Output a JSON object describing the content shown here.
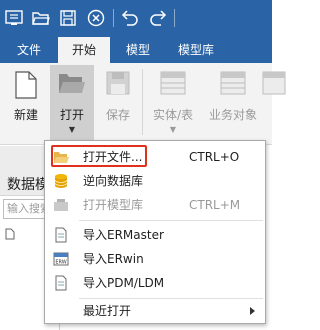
{
  "quick_access": {
    "icons": [
      "app-menu-icon",
      "open-folder-icon",
      "save-icon",
      "close-circle-icon",
      "undo-icon",
      "redo-icon"
    ]
  },
  "tabs": [
    {
      "label": "文件",
      "active": false
    },
    {
      "label": "开始",
      "active": true
    },
    {
      "label": "模型",
      "active": false
    },
    {
      "label": "模型库",
      "active": false
    }
  ],
  "ribbon": {
    "new_label": "新建",
    "open_label": "打开",
    "save_label": "保存",
    "entity_label": "实体/表",
    "business_label": "业务对象"
  },
  "panel": {
    "title": "数据模",
    "search_placeholder": "输入搜索"
  },
  "menu": {
    "items": [
      {
        "label": "打开文件...",
        "shortcut": "CTRL+O",
        "icon": "folder-open-icon",
        "enabled": true
      },
      {
        "label": "逆向数据库",
        "shortcut": "",
        "icon": "database-icon",
        "enabled": true
      },
      {
        "label": "打开模型库",
        "shortcut": "CTRL+M",
        "icon": "model-library-icon",
        "enabled": false
      },
      {
        "label": "导入ERMaster",
        "shortcut": "",
        "icon": "document-icon",
        "enabled": true
      },
      {
        "label": "导入ERwin",
        "shortcut": "",
        "icon": "erwin-icon",
        "enabled": true
      },
      {
        "label": "导入PDM/LDM",
        "shortcut": "",
        "icon": "document-icon",
        "enabled": true
      },
      {
        "label": "最近打开",
        "shortcut": "",
        "icon": "",
        "enabled": true
      }
    ]
  },
  "colors": {
    "brand": "#2b64a6",
    "highlight": "#e0301e",
    "database": "#f2b705"
  }
}
